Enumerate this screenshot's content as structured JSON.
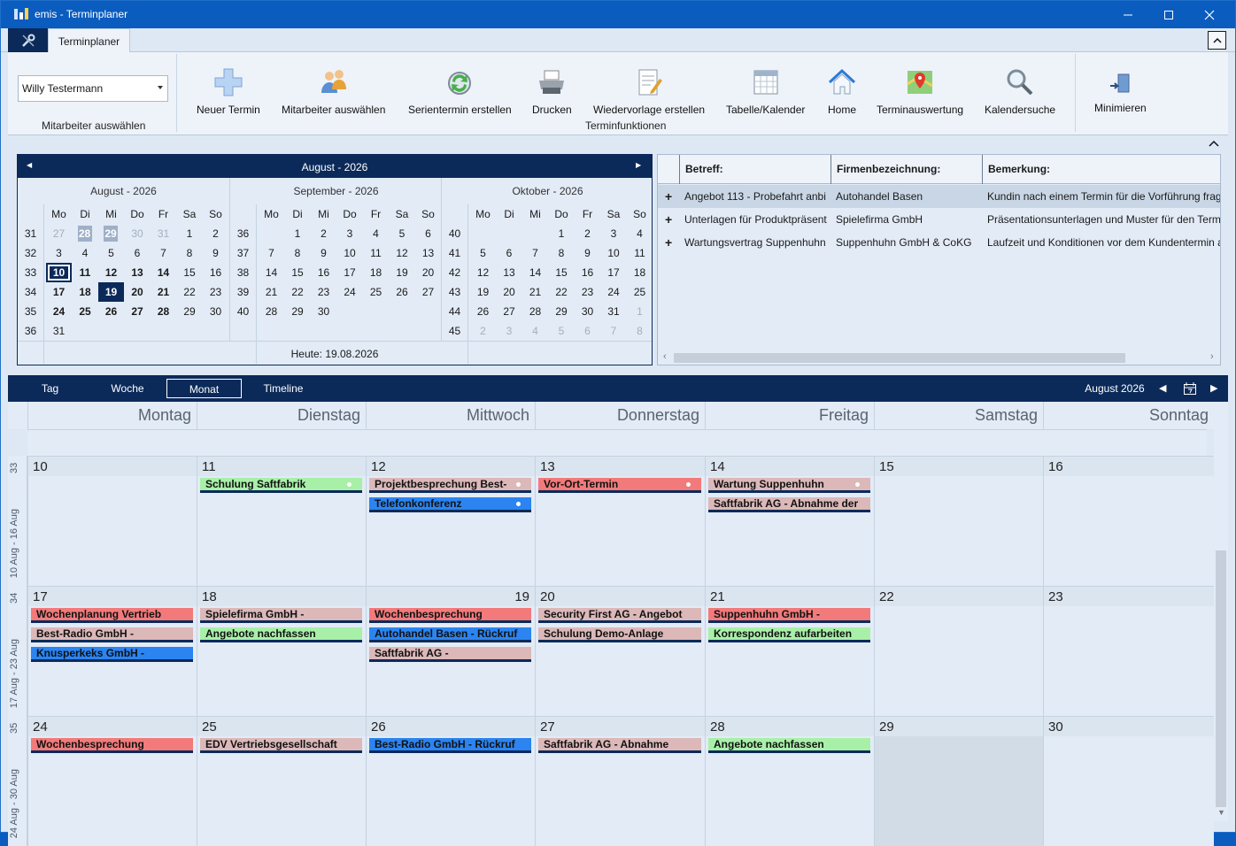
{
  "window": {
    "title": "emis - Terminplaner"
  },
  "ribbon": {
    "tab": "Terminplaner",
    "employee": "Willy Testermann",
    "group_employee": "Mitarbeiter auswählen",
    "group_functions": "Terminfunktionen",
    "buttons": [
      {
        "label": "Neuer Termin",
        "icon": "plus-icon"
      },
      {
        "label": "Mitarbeiter auswählen",
        "icon": "people-icon"
      },
      {
        "label": "Serientermin erstellen",
        "icon": "recurring-icon"
      },
      {
        "label": "Drucken",
        "icon": "printer-icon"
      },
      {
        "label": "Wiedervorlage erstellen",
        "icon": "note-icon"
      },
      {
        "label": "Tabelle/Kalender",
        "icon": "table-icon"
      },
      {
        "label": "Home",
        "icon": "home-icon"
      },
      {
        "label": "Terminauswertung",
        "icon": "map-icon"
      },
      {
        "label": "Kalendersuche",
        "icon": "magnifier-icon"
      }
    ],
    "minimize": "Minimieren"
  },
  "navigator": {
    "header": "August - 2026",
    "today": "Heute: 19.08.2026",
    "weekdays": [
      "Mo",
      "Di",
      "Mi",
      "Do",
      "Fr",
      "Sa",
      "So"
    ],
    "months": [
      {
        "title": "August - 2026",
        "weeks": [
          "31",
          "32",
          "33",
          "34",
          "35",
          "36"
        ],
        "rows": [
          [
            "27",
            "28",
            "29",
            "30",
            "31",
            "1",
            "2"
          ],
          [
            "3",
            "4",
            "5",
            "6",
            "7",
            "8",
            "9"
          ],
          [
            "10",
            "11",
            "12",
            "13",
            "14",
            "15",
            "16"
          ],
          [
            "17",
            "18",
            "19",
            "20",
            "21",
            "22",
            "23"
          ],
          [
            "24",
            "25",
            "26",
            "27",
            "28",
            "29",
            "30"
          ],
          [
            "31",
            "",
            "",
            "",
            "",
            "",
            ""
          ]
        ]
      },
      {
        "title": "September - 2026",
        "weeks": [
          "36",
          "37",
          "38",
          "39",
          "40"
        ],
        "rows": [
          [
            "",
            "1",
            "2",
            "3",
            "4",
            "5",
            "6"
          ],
          [
            "7",
            "8",
            "9",
            "10",
            "11",
            "12",
            "13"
          ],
          [
            "14",
            "15",
            "16",
            "17",
            "18",
            "19",
            "20"
          ],
          [
            "21",
            "22",
            "23",
            "24",
            "25",
            "26",
            "27"
          ],
          [
            "28",
            "29",
            "30",
            "",
            "",
            "",
            ""
          ]
        ]
      },
      {
        "title": "Oktober - 2026",
        "weeks": [
          "40",
          "41",
          "42",
          "43",
          "44",
          "45"
        ],
        "rows": [
          [
            "",
            "",
            "",
            "1",
            "2",
            "3",
            "4"
          ],
          [
            "5",
            "6",
            "7",
            "8",
            "9",
            "10",
            "11"
          ],
          [
            "12",
            "13",
            "14",
            "15",
            "16",
            "17",
            "18"
          ],
          [
            "19",
            "20",
            "21",
            "22",
            "23",
            "24",
            "25"
          ],
          [
            "26",
            "27",
            "28",
            "29",
            "30",
            "31",
            "1"
          ],
          [
            "2",
            "3",
            "4",
            "5",
            "6",
            "7",
            "8"
          ]
        ]
      }
    ]
  },
  "grid": {
    "columns": [
      "Betreff:",
      "Firmenbezeichnung:",
      "Bemerkung:"
    ],
    "rows": [
      [
        "Angebot 113 - Probefahrt anbi",
        "Autohandel Basen",
        "Kundin nach einem Termin für die Vorführung frag"
      ],
      [
        "Unterlagen für Produktpräsent",
        "Spielefirma GmbH",
        "Präsentationsunterlagen und Muster für den Term"
      ],
      [
        "Wartungsvertrag Suppenhuhn",
        "Suppenhuhn GmbH & CoKG",
        "Laufzeit und Konditionen vor dem Kundentermin a"
      ]
    ]
  },
  "calendar": {
    "views": [
      "Tag",
      "Woche",
      "Monat",
      "Timeline"
    ],
    "active_view": "Monat",
    "current": "August 2026",
    "days": [
      "Montag",
      "Dienstag",
      "Mittwoch",
      "Donnerstag",
      "Freitag",
      "Samstag",
      "Sonntag"
    ],
    "weeks": [
      {
        "label": "10 Aug - 16 Aug",
        "num": "33",
        "dates": [
          "10",
          "11",
          "12",
          "13",
          "14",
          "15",
          "16"
        ],
        "appts": [
          [],
          [
            {
              "t": "Schulung Saftfabrik",
              "c": "#a8f0a8",
              "dot": true
            }
          ],
          [
            {
              "t": "Projektbesprechung Best-",
              "c": "#dcb8b8",
              "dot": true
            },
            {
              "t": "Telefonkonferenz",
              "c": "#2b84f0",
              "dot": true
            }
          ],
          [
            {
              "t": "Vor-Ort-Termin",
              "c": "#f27a7a",
              "dot": true
            }
          ],
          [
            {
              "t": "Wartung Suppenhuhn",
              "c": "#dcb8b8",
              "dot": true
            },
            {
              "t": "Saftfabrik AG - Abnahme der",
              "c": "#dcb8b8"
            }
          ],
          [],
          []
        ]
      },
      {
        "label": "17 Aug - 23 Aug",
        "num": "34",
        "dates": [
          "17",
          "18",
          "19",
          "20",
          "21",
          "22",
          "23"
        ],
        "appts": [
          [
            {
              "t": "Wochenplanung Vertrieb",
              "c": "#f27a7a"
            },
            {
              "t": "Best-Radio GmbH -",
              "c": "#dcb8b8"
            },
            {
              "t": "Knusperkeks GmbH -",
              "c": "#2b84f0"
            }
          ],
          [
            {
              "t": "Spielefirma GmbH -",
              "c": "#dcb8b8"
            },
            {
              "t": "Angebote nachfassen",
              "c": "#a8f0a8"
            }
          ],
          [
            {
              "t": "Wochenbesprechung",
              "c": "#f27a7a"
            },
            {
              "t": "Autohandel Basen - Rückruf",
              "c": "#2b84f0"
            },
            {
              "t": "Saftfabrik AG -",
              "c": "#dcb8b8"
            }
          ],
          [
            {
              "t": "Security First AG - Angebot",
              "c": "#dcb8b8"
            },
            {
              "t": "Schulung Demo-Anlage",
              "c": "#dcb8b8"
            }
          ],
          [
            {
              "t": "Suppenhuhn GmbH -",
              "c": "#f27a7a"
            },
            {
              "t": "Korrespondenz aufarbeiten",
              "c": "#a8f0a8"
            }
          ],
          [],
          []
        ]
      },
      {
        "label": "24 Aug - 30 Aug",
        "num": "35",
        "dates": [
          "24",
          "25",
          "26",
          "27",
          "28",
          "29",
          "30"
        ],
        "appts": [
          [
            {
              "t": "Wochenbesprechung",
              "c": "#f27a7a"
            }
          ],
          [
            {
              "t": "EDV Vertriebsgesellschaft",
              "c": "#dcb8b8"
            }
          ],
          [
            {
              "t": "Best-Radio GmbH - Rückruf",
              "c": "#2b84f0"
            }
          ],
          [
            {
              "t": "Saftfabrik AG - Abnahme",
              "c": "#dcb8b8"
            }
          ],
          [
            {
              "t": "Angebote nachfassen",
              "c": "#a8f0a8"
            }
          ],
          [],
          []
        ]
      }
    ]
  }
}
